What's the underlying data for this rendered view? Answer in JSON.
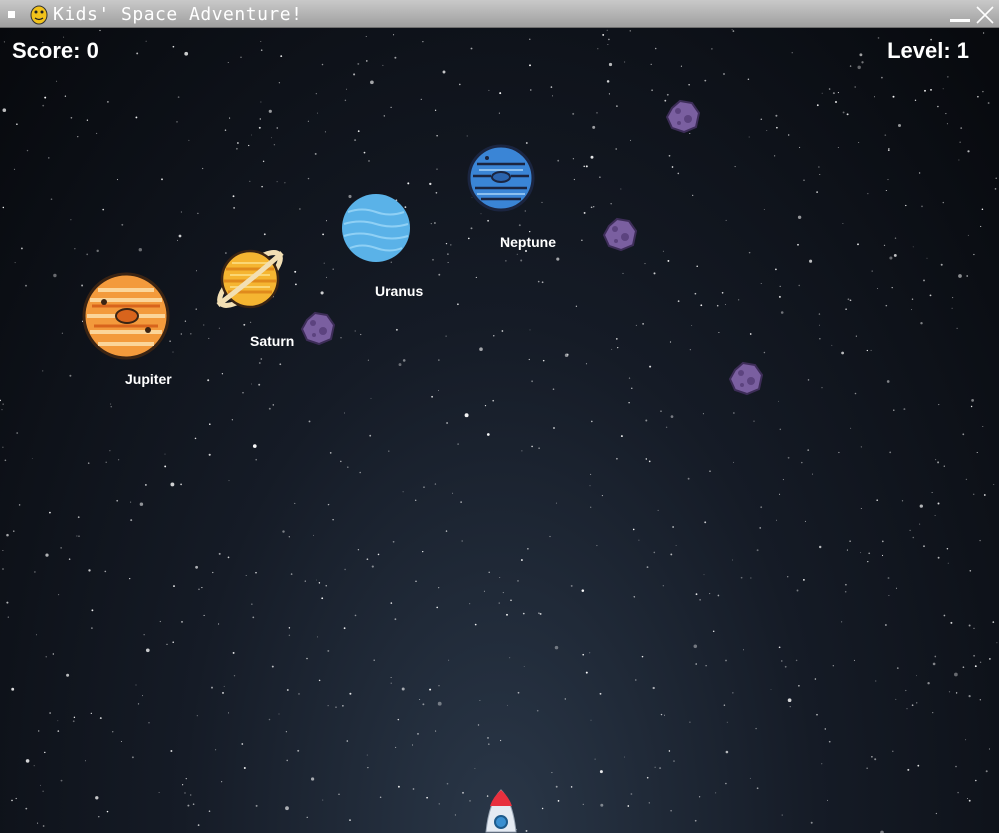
{
  "window": {
    "title": "Kids' Space Adventure!",
    "icons": {
      "app": "pygame-snake-icon",
      "menu": "window-menu-icon",
      "minimize": "minimize-icon",
      "close": "close-icon"
    }
  },
  "hud": {
    "score_text": "Score: 0",
    "level_text": "Level: 1"
  },
  "planets": {
    "jupiter": "Jupiter",
    "saturn": "Saturn",
    "uranus": "Uranus",
    "neptune": "Neptune"
  },
  "colors": {
    "jupiter": "#f39a3c",
    "saturn": "#f5b531",
    "uranus": "#5ab2e8",
    "neptune": "#3a85d6",
    "asteroid": "#7a5fa0",
    "rocket_nose": "#e8303e"
  }
}
